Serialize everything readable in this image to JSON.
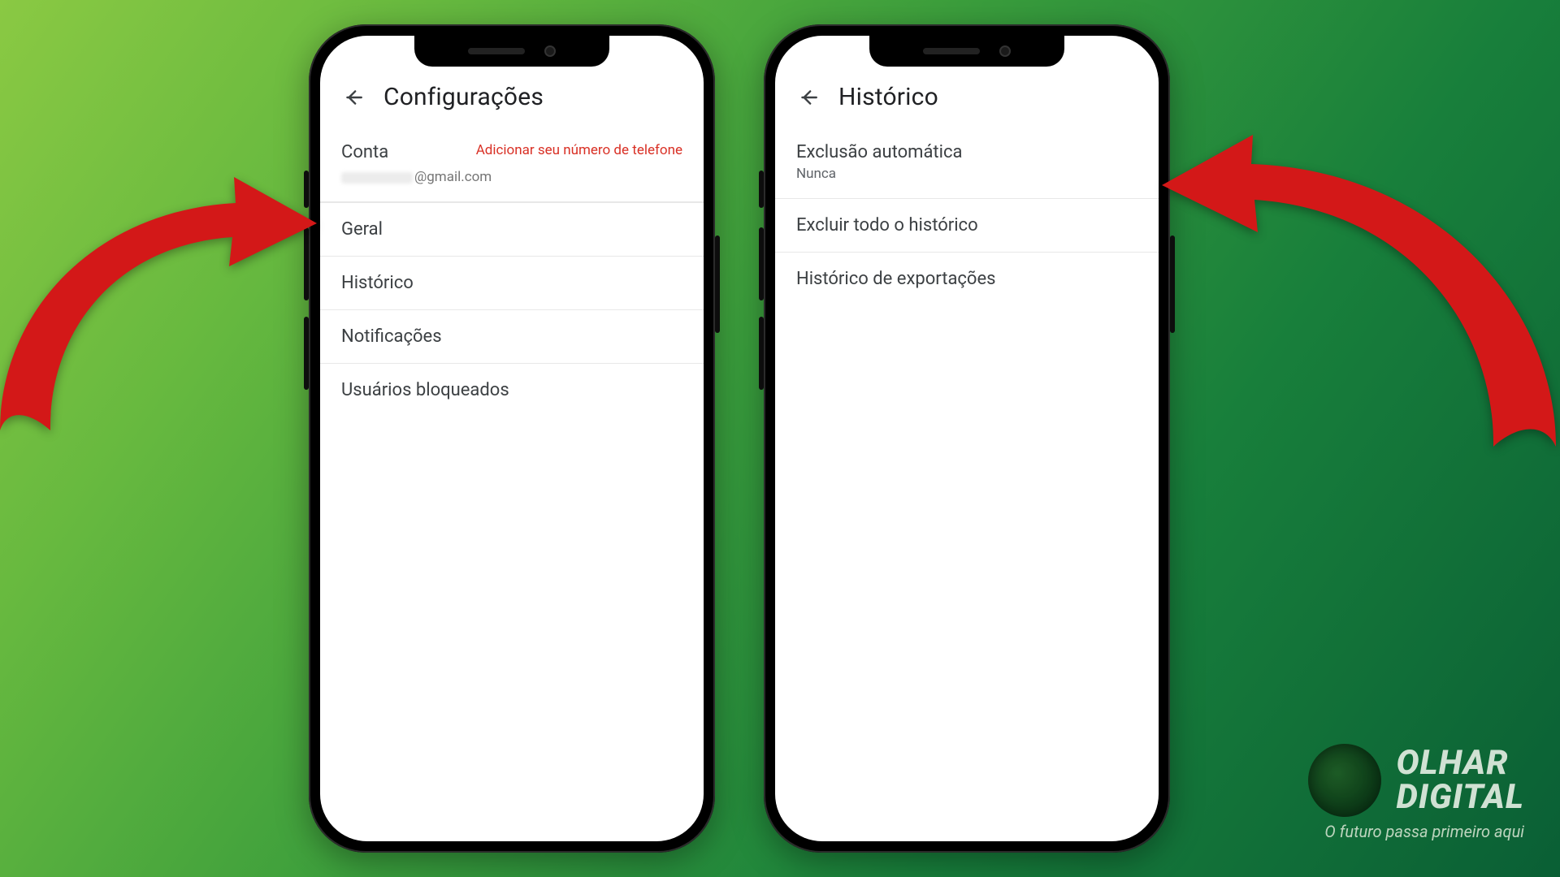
{
  "phone_left": {
    "header_title": "Configurações",
    "account": {
      "label": "Conta",
      "link_text": "Adicionar seu número de telefone",
      "email_suffix": "@gmail.com"
    },
    "menu": {
      "geral": "Geral",
      "historico": "Histórico",
      "notificacoes": "Notificações",
      "usuarios_bloqueados": "Usuários bloqueados"
    }
  },
  "phone_right": {
    "header_title": "Histórico",
    "rows": {
      "auto_delete": {
        "title": "Exclusão automática",
        "sub": "Nunca"
      },
      "delete_all": {
        "title": "Excluir todo o histórico"
      },
      "export": {
        "title": "Histórico de exportações"
      }
    }
  },
  "watermark": {
    "line1": "OLHAR",
    "line2": "DIGITAL",
    "tagline": "O futuro passa primeiro aqui"
  }
}
